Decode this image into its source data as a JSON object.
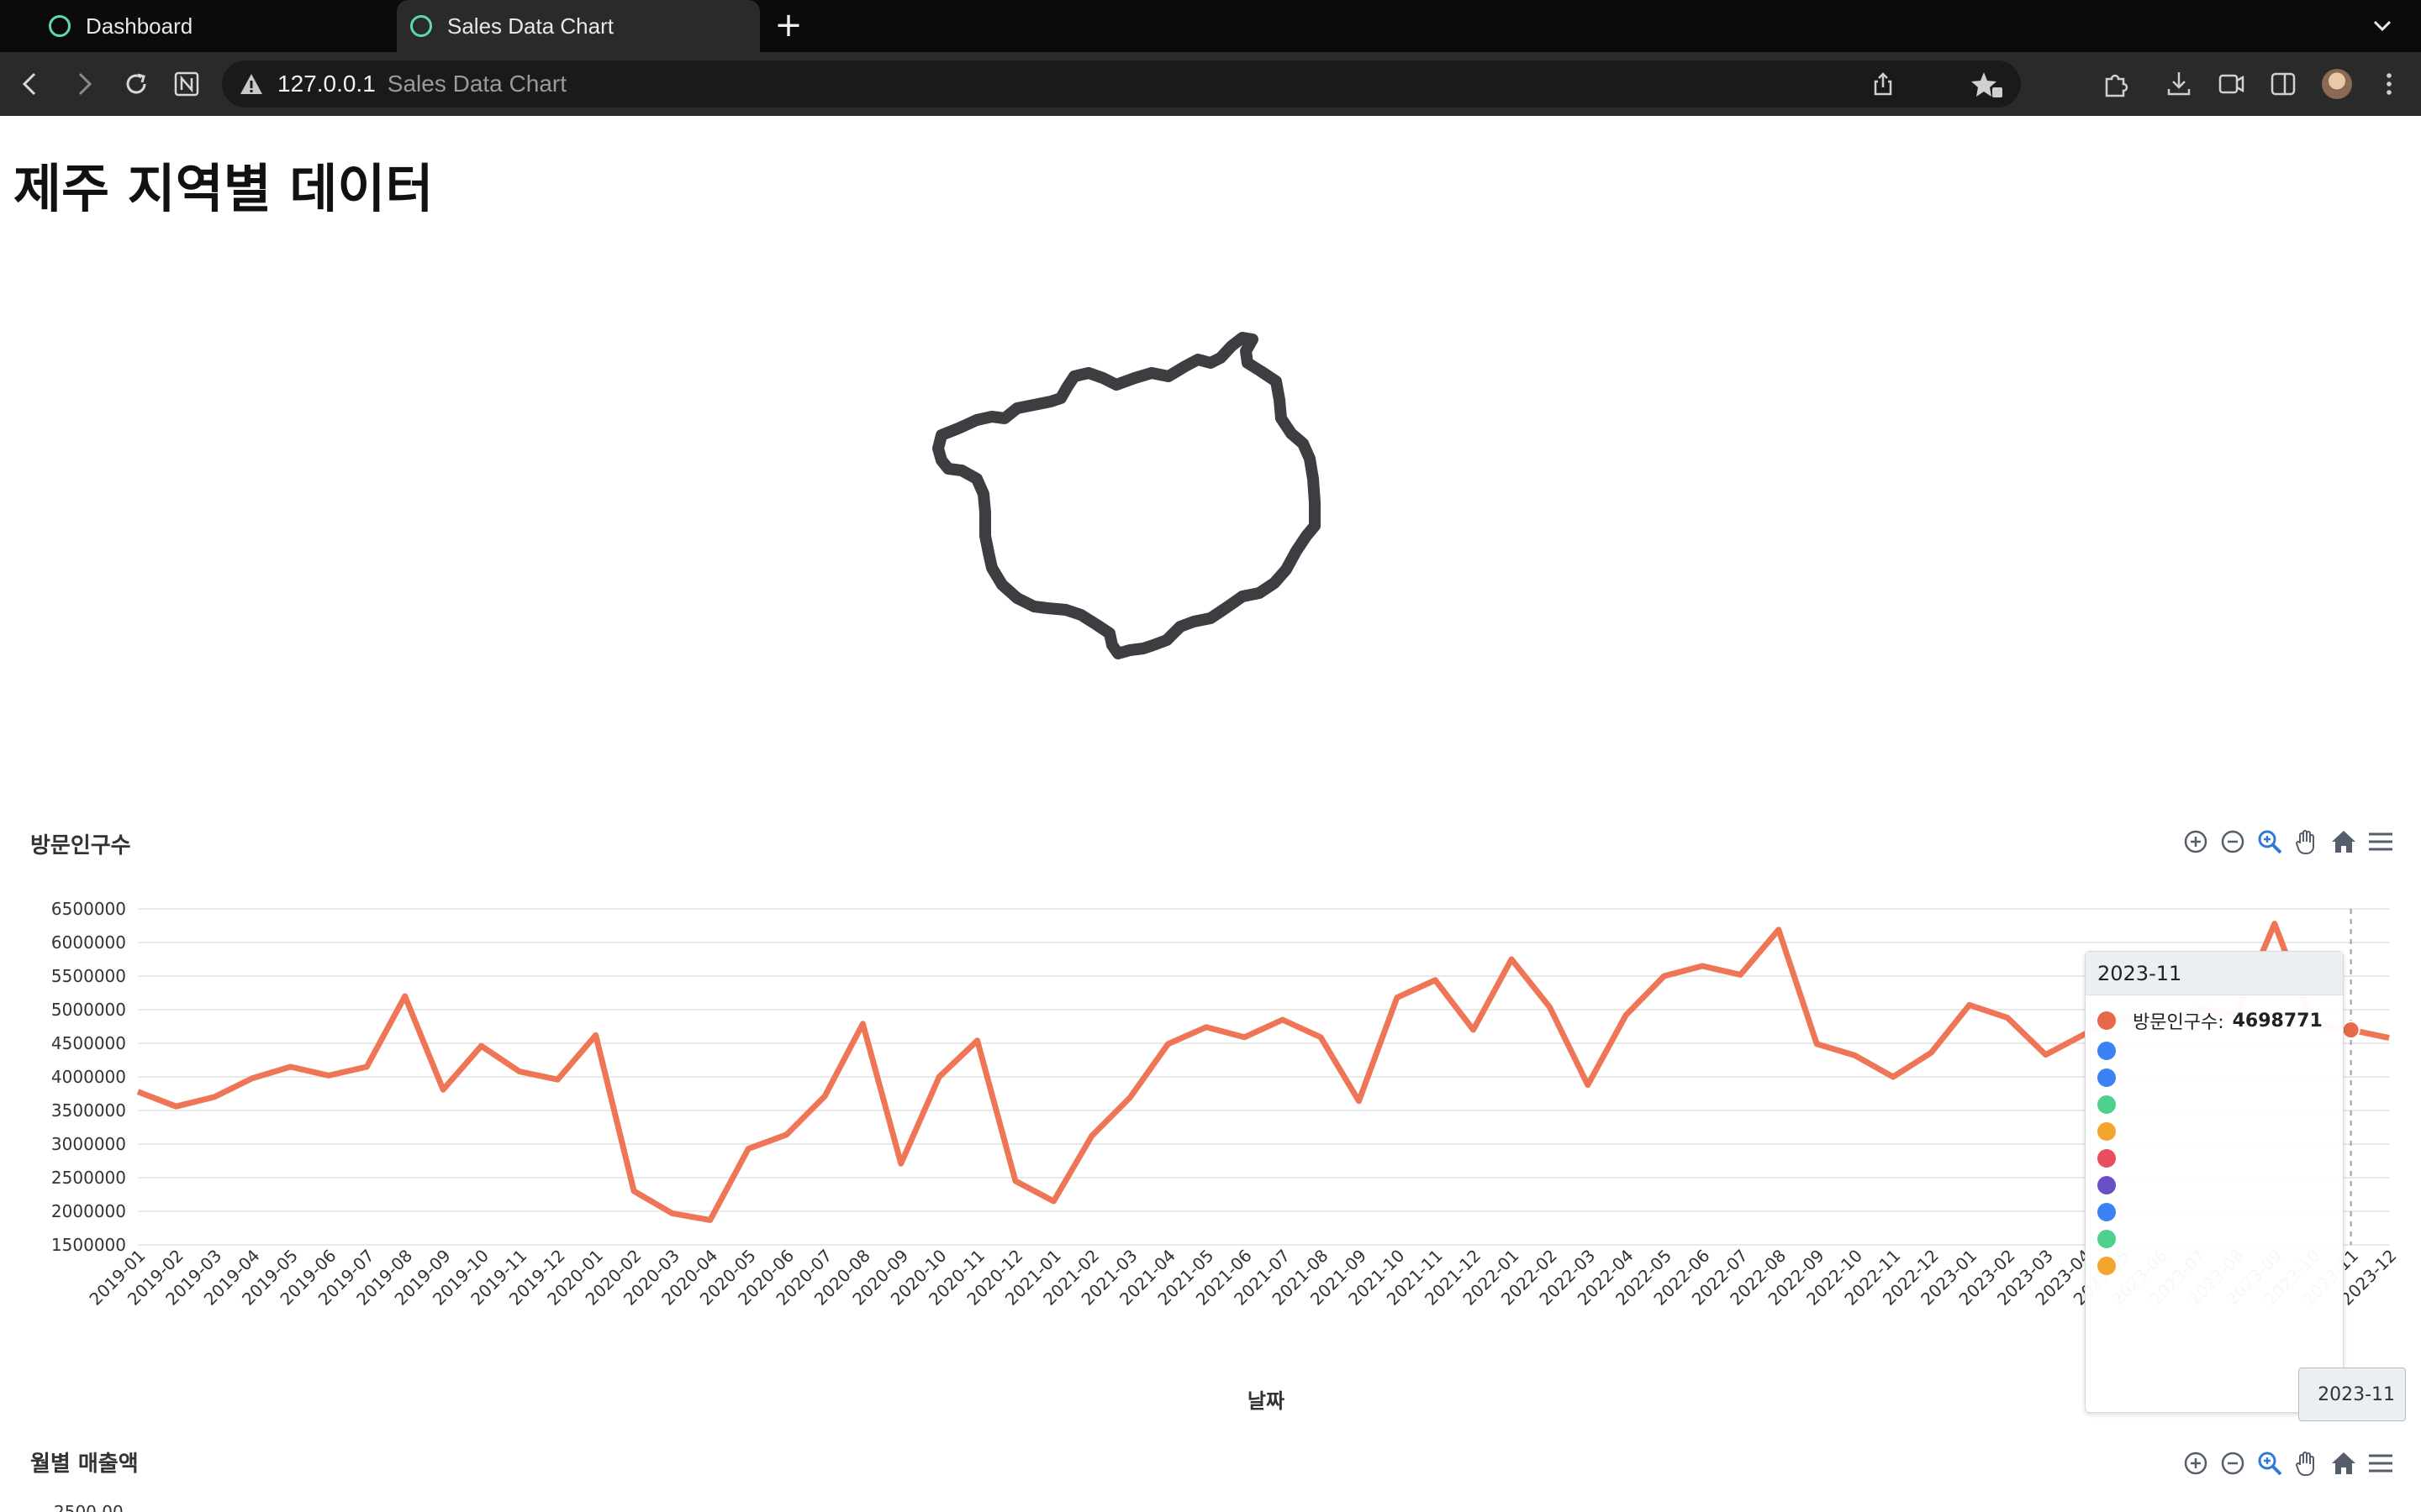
{
  "browser": {
    "tabs": [
      {
        "label": "Dashboard",
        "active": false
      },
      {
        "label": "Sales Data Chart",
        "active": true
      }
    ],
    "new_tab_label": "+",
    "address": {
      "host": "127.0.0.1",
      "page_title": "Sales Data Chart"
    }
  },
  "page": {
    "title": "제주 지역별 데이터"
  },
  "visitors_chart": {
    "title": "방문인구수",
    "x_axis_title": "날짜",
    "toolbar_icons": [
      "zoom-in-icon",
      "zoom-out-icon",
      "zoom-selection-icon",
      "pan-icon",
      "reset-home-icon",
      "menu-icon"
    ],
    "tooltip": {
      "title": "2023-11",
      "series_label": "방문인구수:",
      "series_value": "4698771",
      "marker_colors": [
        "#e8694a",
        "#3b82f6",
        "#3b82f6",
        "#4fd18b",
        "#f4a52f",
        "#e94e5f",
        "#6b4fc6",
        "#3b82f6",
        "#4fd18b",
        "#f4a52f"
      ]
    },
    "hover_x_label": "2023-11",
    "line_color": "#ee7656"
  },
  "sales_chart": {
    "title": "월별 매출액",
    "first_y_tick": "2500.00"
  },
  "chart_data": {
    "type": "line",
    "title": "방문인구수",
    "xlabel": "날짜",
    "ylabel": "",
    "ylim": [
      1500000,
      6500000
    ],
    "y_ticks": [
      "6500000",
      "6000000",
      "5500000",
      "5000000",
      "4500000",
      "4000000",
      "3500000",
      "3000000",
      "2500000",
      "2000000",
      "1500000"
    ],
    "categories": [
      "2019-01",
      "2019-02",
      "2019-03",
      "2019-04",
      "2019-05",
      "2019-06",
      "2019-07",
      "2019-08",
      "2019-09",
      "2019-10",
      "2019-11",
      "2019-12",
      "2020-01",
      "2020-02",
      "2020-03",
      "2020-04",
      "2020-05",
      "2020-06",
      "2020-07",
      "2020-08",
      "2020-09",
      "2020-10",
      "2020-11",
      "2020-12",
      "2021-01",
      "2021-02",
      "2021-03",
      "2021-04",
      "2021-05",
      "2021-06",
      "2021-07",
      "2021-08",
      "2021-09",
      "2021-10",
      "2021-11",
      "2021-12",
      "2022-01",
      "2022-02",
      "2022-03",
      "2022-04",
      "2022-05",
      "2022-06",
      "2022-07",
      "2022-08",
      "2022-09",
      "2022-10",
      "2022-11",
      "2022-12",
      "2023-01",
      "2023-02",
      "2023-03",
      "2023-04",
      "2023-05",
      "2023-06",
      "2023-07",
      "2023-08",
      "2023-09",
      "2023-10",
      "2023-11",
      "2023-12"
    ],
    "series": [
      {
        "name": "방문인구수",
        "values": [
          3780000,
          3560000,
          3700000,
          3980000,
          4150000,
          4020000,
          4150000,
          5200000,
          3810000,
          4460000,
          4080000,
          3960000,
          4620000,
          2300000,
          1970000,
          1870000,
          2930000,
          3140000,
          3710000,
          4790000,
          2710000,
          4000000,
          4540000,
          2450000,
          2150000,
          3120000,
          3690000,
          4490000,
          4740000,
          4590000,
          4850000,
          4590000,
          3640000,
          5180000,
          5440000,
          4700000,
          5750000,
          5040000,
          3880000,
          4920000,
          5500000,
          5650000,
          5520000,
          6190000,
          4490000,
          4320000,
          4000000,
          4360000,
          5070000,
          4880000,
          4330000,
          4630000,
          4890000,
          4760000,
          5010000,
          4940000,
          6280000,
          4790000,
          4698771,
          4580000
        ]
      }
    ],
    "grid": true,
    "legend": "none"
  }
}
